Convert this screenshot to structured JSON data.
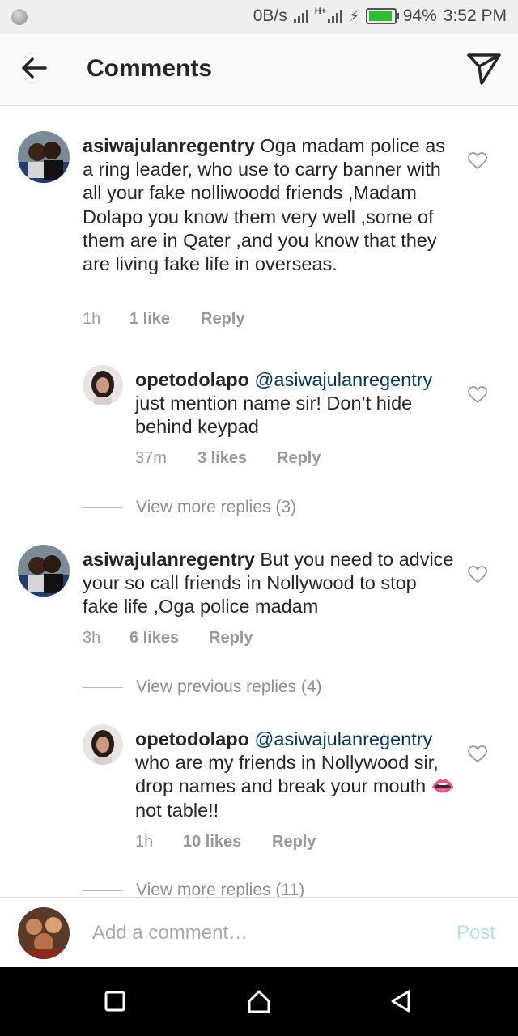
{
  "status_bar": {
    "net_speed": "0B/s",
    "network_label": "H+",
    "battery_percent": "94%",
    "battery_level": 0.94,
    "time": "3:52 PM"
  },
  "header": {
    "title": "Comments",
    "back_icon": "arrow-left-icon",
    "send_icon": "paper-plane-icon"
  },
  "comments": [
    {
      "username": "asiwajulanregentry",
      "text": "Oga madam police as a ring leader, who use to carry banner with all your fake nolliwoodd friends ,Madam Dolapo you know them very well ,some of them are in Qater ,and you know that they are living fake life in overseas.",
      "time": "1h",
      "likes": "1 like",
      "reply": "Reply"
    },
    {
      "username": "opetodolapo",
      "mention": "@asiwajulanregentry",
      "text": "just mention name sir! Don’t hide behind keypad",
      "time": "37m",
      "likes": "3 likes",
      "reply": "Reply"
    },
    {
      "username": "asiwajulanregentry",
      "text": "But you need to advice your so call friends in Nollywood to stop fake life ,Oga police madam",
      "time": "3h",
      "likes": "6 likes",
      "reply": "Reply"
    },
    {
      "username": "opetodolapo",
      "mention": "@asiwajulanregentry",
      "text": "who are my friends in Nollywood sir, drop names and break your mouth",
      "emoji": "👄",
      "text_after": "not table!!",
      "time": "1h",
      "likes": "10 likes",
      "reply": "Reply"
    }
  ],
  "view_more_1": "View more replies (3)",
  "view_previous": "View previous replies (4)",
  "view_more_2": "View more replies (11)",
  "footer": {
    "placeholder": "Add a comment…",
    "post_label": "Post"
  },
  "colors": {
    "mention": "#003569",
    "post_disabled": "#b2dffc",
    "battery": "#27c22b"
  }
}
